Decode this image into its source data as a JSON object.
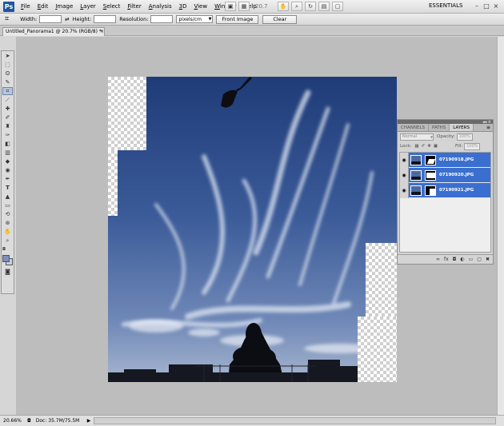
{
  "menubar": {
    "logo": "Ps",
    "items": [
      "File",
      "Edit",
      "Image",
      "Layer",
      "Select",
      "Filter",
      "Analysis",
      "3D",
      "View",
      "Window",
      "Help"
    ],
    "zoom": "20.7",
    "workspace": "ESSENTIALS",
    "window_controls": [
      "–",
      "□",
      "×"
    ]
  },
  "options": {
    "width_label": "Width:",
    "height_label": "Height:",
    "resolution_label": "Resolution:",
    "resolution_unit": "pixels/cm",
    "front_image_label": "Front Image",
    "clear_label": "Clear"
  },
  "document": {
    "tab_title": "Untitled_Panorama1 @ 20.7% (RGB/8) *",
    "close": "×"
  },
  "status": {
    "zoom": "20.66%",
    "doc_size": "Doc: 35.7M/75.5M"
  },
  "layers_panel": {
    "tabs": [
      "CHANNELS",
      "PATHS",
      "LAYERS"
    ],
    "active_tab": "LAYERS",
    "blend_mode": "Normal",
    "opacity_label": "Opacity:",
    "opacity_value": "100%",
    "lock_label": "Lock:",
    "fill_label": "Fill:",
    "fill_value": "100%",
    "layers": [
      {
        "name": "07190918.JPG"
      },
      {
        "name": "07190920.JPG"
      },
      {
        "name": "07190921.JPG"
      }
    ]
  },
  "colors": {
    "selection": "#3a6fd0",
    "ps_blue": "#1e56a0",
    "sky_top": "#22417e",
    "sky_bottom": "#8fa4c6"
  }
}
